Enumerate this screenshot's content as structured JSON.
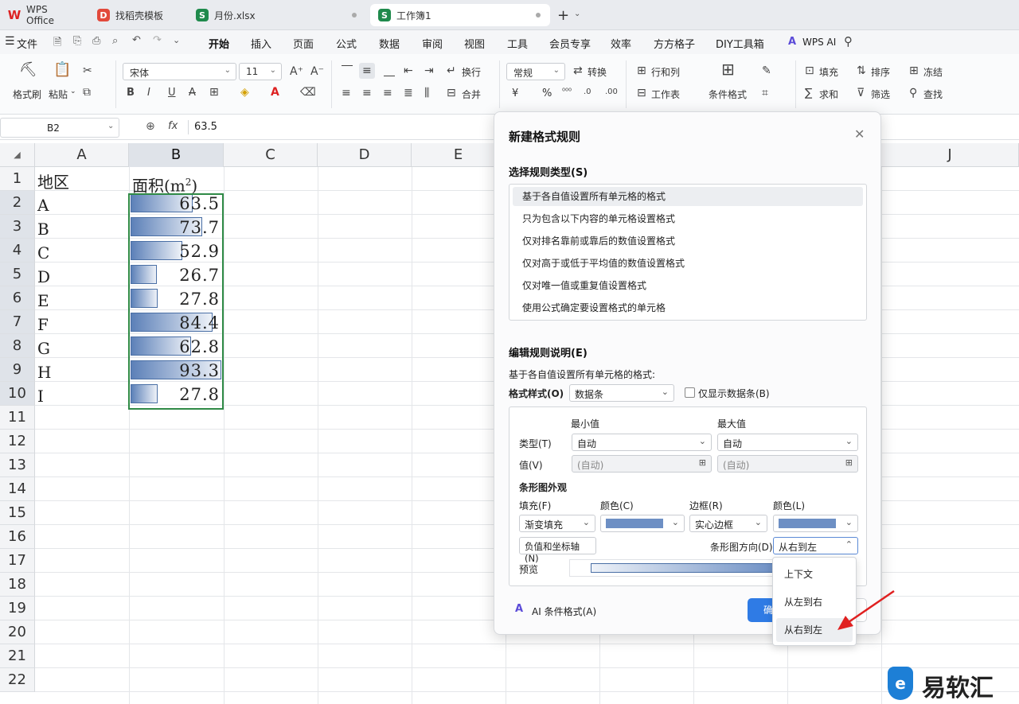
{
  "tabs": [
    {
      "label": "WPS Office",
      "icon": "W"
    },
    {
      "label": "找稻壳模板",
      "icon": "D"
    },
    {
      "label": "月份.xlsx",
      "icon": "S"
    },
    {
      "label": "工作簿1",
      "icon": "S"
    }
  ],
  "menu": {
    "file": "文件",
    "items": [
      "开始",
      "插入",
      "页面",
      "公式",
      "数据",
      "审阅",
      "视图",
      "工具",
      "会员专享",
      "效率",
      "方方格子",
      "DIY工具箱"
    ],
    "active": "开始",
    "ai": "WPS AI"
  },
  "ribbon": {
    "format_painter": "格式刷",
    "paste": "粘贴",
    "font_name": "宋体",
    "font_size": "11",
    "bold": "B",
    "italic": "I",
    "underline": "U",
    "strike": "A",
    "wrap": "换行",
    "merge": "合并",
    "number_format": "常规",
    "convert": "转换",
    "currency": "¥",
    "percent": "%",
    "rows_cols": "行和列",
    "worksheet": "工作表",
    "cond_format": "条件格式",
    "fill": "填充",
    "sort": "排序",
    "freeze": "冻结",
    "sum": "求和",
    "filter": "筛选",
    "find": "查找"
  },
  "formula_bar": {
    "cell_ref": "B2",
    "fx": "fx",
    "value": "63.5"
  },
  "grid": {
    "columns": [
      "A",
      "B",
      "C",
      "D",
      "E",
      "F",
      "G",
      "H",
      "I",
      "J"
    ],
    "selected_column": "B",
    "rows": [
      "1",
      "2",
      "3",
      "4",
      "5",
      "6",
      "7",
      "8",
      "9",
      "10",
      "11",
      "12",
      "13",
      "14",
      "15",
      "16",
      "17",
      "18",
      "19",
      "20",
      "21",
      "22"
    ],
    "header_a": "地区",
    "header_b": "面积(m",
    "header_b_sup": "2",
    "header_b_close": ")",
    "data": [
      {
        "region": "A",
        "value": "63.5",
        "fill": 0.68
      },
      {
        "region": "B",
        "value": "73.7",
        "fill": 0.79
      },
      {
        "region": "C",
        "value": "52.9",
        "fill": 0.57
      },
      {
        "region": "D",
        "value": "26.7",
        "fill": 0.29
      },
      {
        "region": "E",
        "value": "27.8",
        "fill": 0.3
      },
      {
        "region": "F",
        "value": "84.4",
        "fill": 0.9
      },
      {
        "region": "G",
        "value": "62.8",
        "fill": 0.67
      },
      {
        "region": "H",
        "value": "93.3",
        "fill": 1.0
      },
      {
        "region": "I",
        "value": "27.8",
        "fill": 0.3
      }
    ]
  },
  "dialog": {
    "title": "新建格式规则",
    "rule_type_label": "选择规则类型(S)",
    "rule_types": [
      "基于各自值设置所有单元格的格式",
      "只为包含以下内容的单元格设置格式",
      "仅对排名靠前或靠后的数值设置格式",
      "仅对高于或低于平均值的数值设置格式",
      "仅对唯一值或重复值设置格式",
      "使用公式确定要设置格式的单元格"
    ],
    "edit_label": "编辑规则说明(E)",
    "desc": "基于各自值设置所有单元格的格式:",
    "format_style_label": "格式样式(O)",
    "format_style": "数据条",
    "show_bar_only": "仅显示数据条(B)",
    "min_label": "最小值",
    "max_label": "最大值",
    "type_label": "类型(T)",
    "min_type": "自动",
    "max_type": "自动",
    "value_label": "值(V)",
    "min_value": "(自动)",
    "max_value": "(自动)",
    "bar_appearance": "条形图外观",
    "fill_label": "填充(F)",
    "color_label": "颜色(C)",
    "border_label": "边框(R)",
    "border_color_label": "颜色(L)",
    "fill_value": "渐变填充",
    "border_value": "实心边框",
    "bar_color": "#6d8fc4",
    "neg_axis": "负值和坐标轴(N)",
    "direction_label": "条形图方向(D)",
    "direction_value": "从右到左",
    "preview_label": "预览",
    "ai_cond": "AI 条件格式(A)",
    "ok": "确"
  },
  "dropdown": {
    "options": [
      "上下文",
      "从左到右",
      "从右到左"
    ],
    "selected": "从右到左"
  },
  "watermark": "易软汇"
}
